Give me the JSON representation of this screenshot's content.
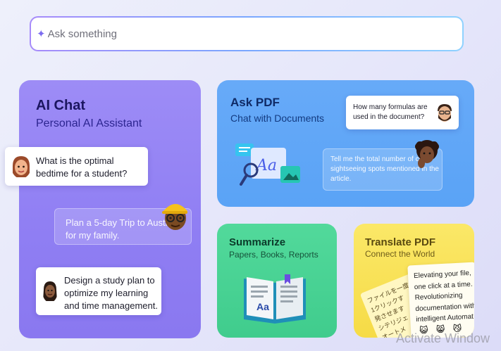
{
  "search": {
    "placeholder": "Ask something",
    "icon": "sparkle-icon"
  },
  "ai_chat": {
    "title": "AI Chat",
    "subtitle": "Personal AI Assistant",
    "bubbles": [
      "What is the optimal bedtime for a student?",
      "Plan a 5-day Trip to Australia for my family.",
      "Design a study plan to optimize my learning and time management."
    ]
  },
  "ask_pdf": {
    "title": "Ask PDF",
    "subtitle": "Chat with Documents",
    "bubbles": [
      "How many formulas are used in the document?",
      "Tell me the total number of city sightseeing spots mentioned in the article."
    ]
  },
  "summarize": {
    "title": "Summarize",
    "subtitle": "Papers, Books, Reports",
    "book_label": "Aa"
  },
  "translate": {
    "title": "Translate PDF",
    "subtitle": "Connect the World",
    "jp_lines": [
      "ファイルを一度",
      "1クリックす",
      "発させます",
      "シテリジェ",
      "オートメ"
    ],
    "en_lines": [
      "Elevating your file,",
      "one click at a time.",
      "Revolutionizing",
      "documentation with",
      "intelligent Automat"
    ],
    "emojis": [
      "😺",
      "😸",
      "😼"
    ]
  },
  "watermark": "Activate Window",
  "colors": {
    "ai_chat": "#9486f4",
    "ask_pdf": "#62a7f7",
    "summarize": "#4bd496",
    "translate": "#f8e255"
  }
}
